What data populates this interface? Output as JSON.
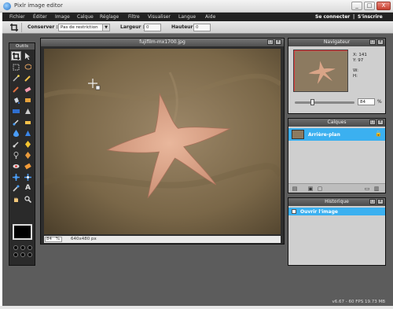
{
  "window": {
    "title": "Pixlr image editor",
    "minimize": "_",
    "maximize": "□",
    "close": "X"
  },
  "menu": {
    "items": [
      "Fichier",
      "Éditer",
      "Image",
      "Calque",
      "Réglage",
      "Filtre",
      "Visualiser",
      "Langue",
      "Aide"
    ],
    "login": "Se connecter",
    "separator": "|",
    "register": "S'inscrire"
  },
  "options": {
    "keep_label": "Conserver :",
    "keep_value": "Pas de restriction",
    "width_label": "Largeur :",
    "width_value": "0",
    "height_label": "Hauteur :",
    "height_value": "0"
  },
  "tools": {
    "header": "Outils",
    "icons": [
      "crop-icon",
      "move-icon",
      "marquee-icon",
      "lasso-icon",
      "wand-icon",
      "pencil-icon",
      "brush-icon",
      "eraser-icon",
      "bucket-icon",
      "gradient-icon",
      "clone-icon",
      "color-replace-icon",
      "drawing-icon",
      "blur-icon",
      "sharpen-icon",
      "smudge-icon",
      "sponge-icon",
      "dodge-icon",
      "burn-icon",
      "redeye-icon",
      "spot-heal-icon",
      "bloat-icon",
      "pinch-icon",
      "colorpicker-icon",
      "type-icon",
      "hand-icon",
      "zoom-icon"
    ]
  },
  "document": {
    "title": "fujifilm-mx1700.jpg",
    "zoom": "84",
    "zoom_unit": "%",
    "dimensions": "640x480 px"
  },
  "navigator": {
    "title": "Navigateur",
    "x_label": "X:",
    "x_value": "141",
    "y_label": "Y:",
    "y_value": "97",
    "w_label": "W:",
    "w_value": "",
    "h_label": "H:",
    "h_value": "",
    "zoom": "84",
    "zoom_unit": "%"
  },
  "layers": {
    "title": "Calques",
    "items": [
      {
        "name": "Arrière-plan"
      }
    ]
  },
  "history": {
    "title": "Historique",
    "items": [
      {
        "label": "Ouvrir l'image"
      }
    ]
  },
  "status": {
    "text": "v6.67 - 60 FPS 19.73 MB"
  },
  "colors": {
    "accent": "#3bb0f0",
    "menubar": "#222222",
    "background": "#5c5c5c",
    "nav_rect": "#e03b3b"
  }
}
